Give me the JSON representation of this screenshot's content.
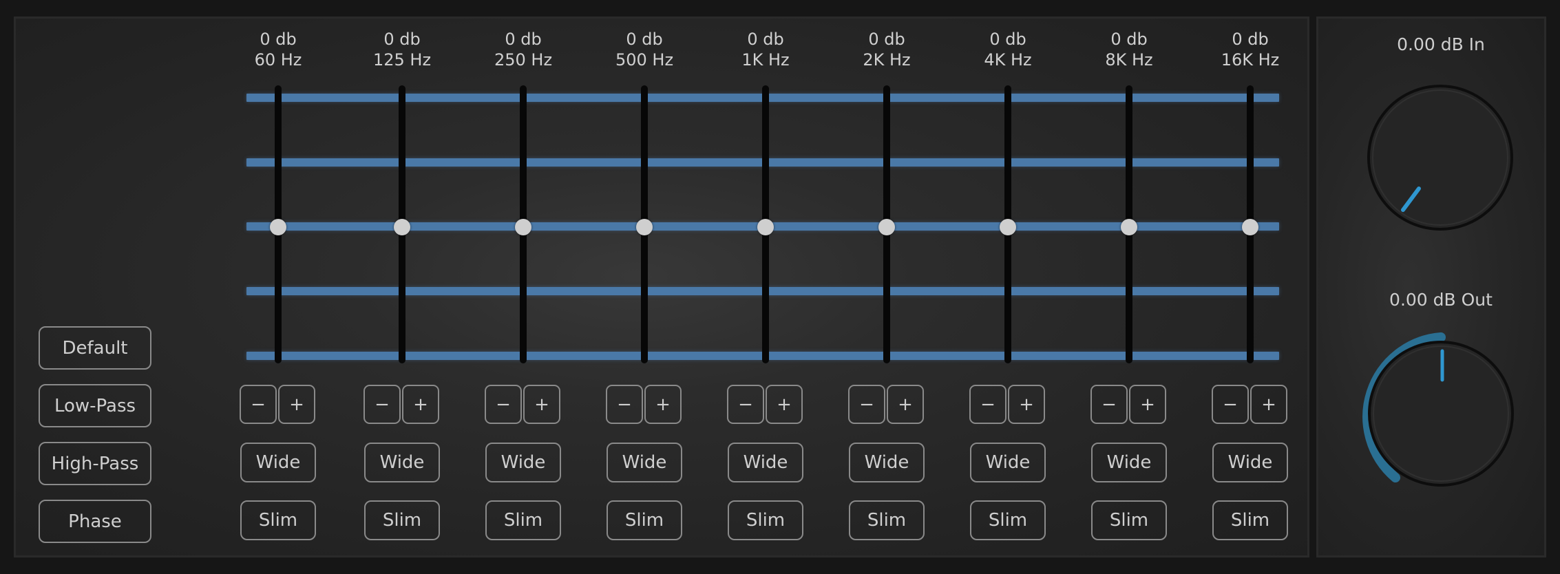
{
  "bands": [
    {
      "gain": "0 db",
      "freq": "60 Hz",
      "minus": "−",
      "plus": "+",
      "wide": "Wide",
      "slim": "Slim",
      "gain_value": 0
    },
    {
      "gain": "0 db",
      "freq": "125 Hz",
      "minus": "−",
      "plus": "+",
      "wide": "Wide",
      "slim": "Slim",
      "gain_value": 0
    },
    {
      "gain": "0 db",
      "freq": "250 Hz",
      "minus": "−",
      "plus": "+",
      "wide": "Wide",
      "slim": "Slim",
      "gain_value": 0
    },
    {
      "gain": "0 db",
      "freq": "500 Hz",
      "minus": "−",
      "plus": "+",
      "wide": "Wide",
      "slim": "Slim",
      "gain_value": 0
    },
    {
      "gain": "0 db",
      "freq": "1K Hz",
      "minus": "−",
      "plus": "+",
      "wide": "Wide",
      "slim": "Slim",
      "gain_value": 0
    },
    {
      "gain": "0 db",
      "freq": "2K Hz",
      "minus": "−",
      "plus": "+",
      "wide": "Wide",
      "slim": "Slim",
      "gain_value": 0
    },
    {
      "gain": "0 db",
      "freq": "4K Hz",
      "minus": "−",
      "plus": "+",
      "wide": "Wide",
      "slim": "Slim",
      "gain_value": 0
    },
    {
      "gain": "0 db",
      "freq": "8K Hz",
      "minus": "−",
      "plus": "+",
      "wide": "Wide",
      "slim": "Slim",
      "gain_value": 0
    },
    {
      "gain": "0 db",
      "freq": "16K Hz",
      "minus": "−",
      "plus": "+",
      "wide": "Wide",
      "slim": "Slim",
      "gain_value": 0
    }
  ],
  "left_buttons": {
    "default": "Default",
    "low_pass": "Low-Pass",
    "high_pass": "High-Pass",
    "phase": "Phase"
  },
  "input_knob": {
    "label": "0.00 dB In",
    "value_db": 0.0
  },
  "output_knob": {
    "label": "0.00 dB Out",
    "value_db": 0.0
  },
  "colors": {
    "accent": "#4a79a8",
    "knob_indicator": "#2f97d0",
    "knob_arc": "#2a6f92"
  }
}
